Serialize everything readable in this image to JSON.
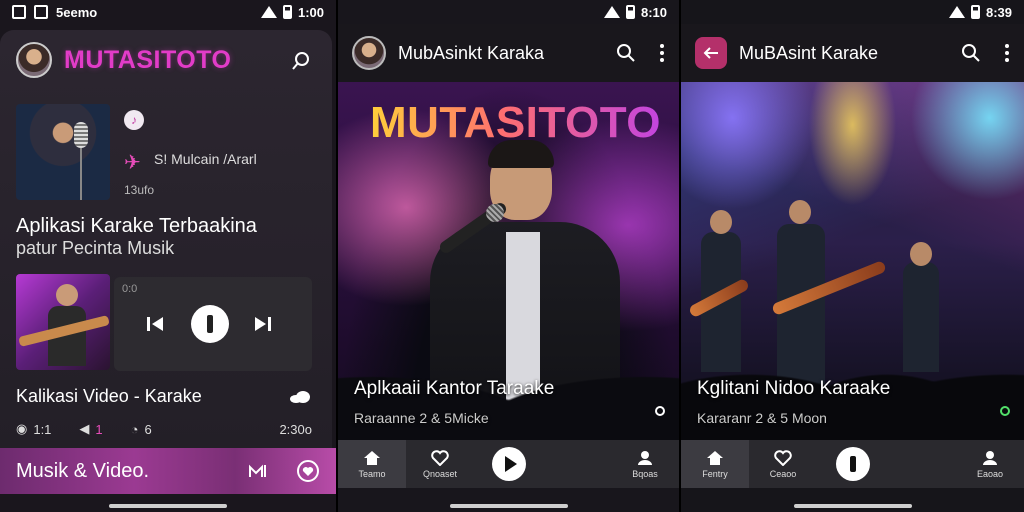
{
  "panel1": {
    "status": {
      "left": "5eemo",
      "time": "1:00"
    },
    "brand": "MUTASITOTO",
    "song": {
      "artist": "S! Mulcain /Ararl",
      "meta": "13ufo"
    },
    "title": "Aplikasi Karake Terbaakina",
    "subtitle": "patur Pecinta Musik",
    "player_label": "0:0",
    "video_title": "Kalikasi Video - Karake",
    "stats": {
      "views": "1:1",
      "likes": "1",
      "comments": "6",
      "duration": "2:30o"
    },
    "bottom_bar_label": "Musik & Video."
  },
  "panel2": {
    "status": {
      "time": "8:10"
    },
    "app_title": "MubAsinkt Karaka",
    "hero_brand": "MUTASITOTO",
    "caption": "Aplkaaii Kantor Taraake",
    "caption_sub": "Raraanne 2 & 5Micke",
    "nav": {
      "home": "Teamo",
      "fav": "Qnoaset",
      "profile": "Bqoas"
    }
  },
  "panel3": {
    "status": {
      "time": "8:39"
    },
    "app_title": "MuBAsint Karake",
    "caption": "Kglitani Nidoo Karaake",
    "caption_sub": "Kararanr 2 & 5 Moon",
    "nav": {
      "home": "Fentry",
      "fav": "Ceaoo",
      "profile": "Eaoao"
    }
  },
  "colors": {
    "brand_pink": "#e23cc8",
    "bar_purple": "#9b3a92",
    "back_button": "#b4306a"
  },
  "icons": [
    "search-icon",
    "more-vert-icon",
    "back-arrow-icon",
    "home-icon",
    "heart-icon",
    "play-icon",
    "pause-icon",
    "profile-icon",
    "prev-icon",
    "next-icon",
    "wifi-icon",
    "battery-icon"
  ]
}
